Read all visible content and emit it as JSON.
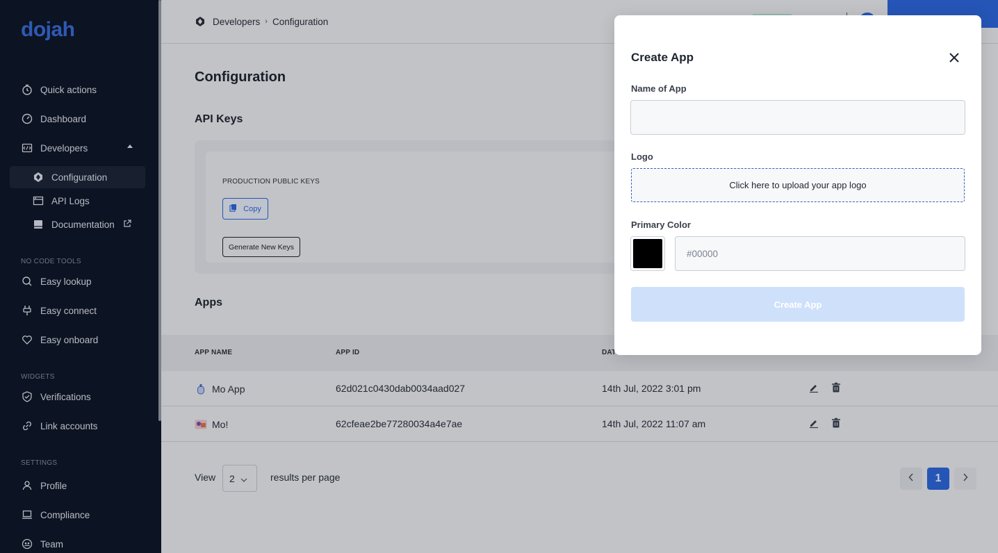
{
  "app": {
    "logo": "dojah"
  },
  "sidebar": {
    "items": [
      {
        "label": "Quick actions",
        "icon": "timer-icon"
      },
      {
        "label": "Dashboard",
        "icon": "speedometer-icon"
      },
      {
        "label": "Developers",
        "icon": "code-window-icon",
        "expanded": true
      },
      {
        "label": "Configuration",
        "icon": "diamond-icon",
        "active": true
      },
      {
        "label": "API Logs",
        "icon": "browser-window-icon"
      },
      {
        "label": "Documentation",
        "icon": "book-icon"
      }
    ],
    "no_code_label": "NO CODE TOOLS",
    "no_code_items": [
      {
        "label": "Easy lookup",
        "icon": "search-icon"
      },
      {
        "label": "Easy connect",
        "icon": "plug-icon"
      },
      {
        "label": "Easy onboard",
        "icon": "heart-hand-icon"
      }
    ],
    "widgets_label": "WIDGETS",
    "widget_items": [
      {
        "label": "Verifications",
        "icon": "shield-check-icon"
      },
      {
        "label": "Link accounts",
        "icon": "link-icon"
      }
    ],
    "settings_label": "SETTINGS",
    "settings_items": [
      {
        "label": "Profile",
        "icon": "user-icon"
      },
      {
        "label": "Compliance",
        "icon": "laptop-icon"
      },
      {
        "label": "Team",
        "icon": "team-icon"
      }
    ]
  },
  "breadcrumb": {
    "parent": "Developers",
    "current": "Configuration"
  },
  "page": {
    "title": "Configuration",
    "api_keys_title": "API Keys",
    "production_public_keys": "PRODUCTION PUBLIC KEYS",
    "copy_label": "Copy",
    "generate_label": "Generate New Keys",
    "apps_title": "Apps"
  },
  "table": {
    "headers": [
      "APP NAME",
      "APP ID",
      "DATE"
    ],
    "header_visible": [
      "APP NAME",
      "APP ID",
      "DAT"
    ],
    "rows": [
      {
        "name": "Mo App",
        "id": "62d021c0430dab0034aad027",
        "date": "14th Jul, 2022 3:01 pm"
      },
      {
        "name": "Mo!",
        "id": "62cfeae2be77280034a4e7ae",
        "date": "14th Jul, 2022 11:07 am"
      }
    ]
  },
  "pagination": {
    "view_label": "View",
    "per_page_value": "2",
    "results_label": "results per page",
    "current_page": "1"
  },
  "modal": {
    "title": "Create App",
    "name_label": "Name of App",
    "name_value": "",
    "logo_label": "Logo",
    "upload_text": "Click here to upload your app logo",
    "color_label": "Primary Color",
    "color_swatch": "#000000",
    "color_placeholder": "#00000",
    "submit_label": "Create App"
  },
  "colors": {
    "sidebar_bg": "#0d1526",
    "accent": "#2d6ae3",
    "disabled_button": "#cfe0fb"
  }
}
